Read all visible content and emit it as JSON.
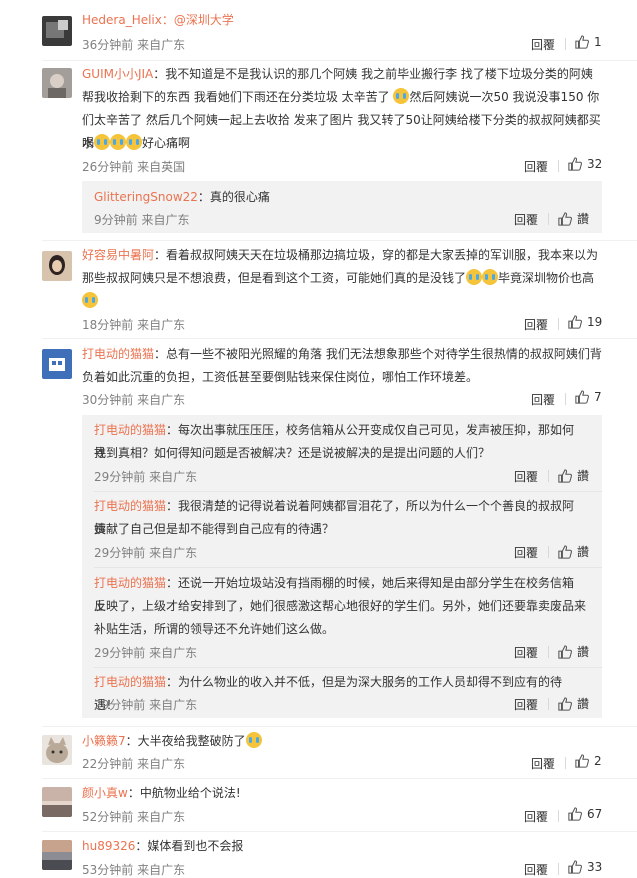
{
  "comments": [
    {
      "user": "Hedera_Helix",
      "text": "：@深圳大学",
      "time": "36分钟前 来自广东",
      "reply": "回覆",
      "likes": "1",
      "avatar": "dark"
    },
    {
      "user": "GUIM小小JIA",
      "lines": [
        "：我不知道是不是我认识的那几个阿姨 我之前毕业搬行李 找了楼下垃圾分类的阿姨",
        "帮我收拾剩下的东西 我看她们下雨还在分类垃圾 太辛苦了",
        "们太辛苦了 然后几个阿姨一起上去收拾 发来了图片 我又转了50让阿姨给楼下分类的叔叔阿姨都买水",
        "喝"
      ],
      "line2_suffix": "然后阿姨说一次50 我说没事150 你",
      "line4_suffix": "好心痛啊",
      "time": "26分钟前 来自英国",
      "reply": "回覆",
      "likes": "32",
      "avatar": "gray",
      "sub": [
        {
          "user": "GlitteringSnow22",
          "text": "：真的很心痛",
          "time": "9分钟前 来自广东",
          "reply": "回覆",
          "likes": "讚"
        }
      ]
    },
    {
      "user": "好容易中暑阿",
      "lines": [
        "：看着叔叔阿姨天天在垃圾桶那边搞垃圾，穿的都是大家丢掉的军训服，我本来以为",
        "那些叔叔阿姨只是不想浪费，但是看到这个工资，可能她们真的是没钱了"
      ],
      "line2_suffix": "毕竟深圳物价也高",
      "time": "18分钟前 来自广东",
      "reply": "回覆",
      "likes": "19",
      "avatar": "girl"
    },
    {
      "user": "打电动的猫猫",
      "lines": [
        "：总有一些不被阳光照耀的角落 我们无法想象那些个对待学生很热情的叔叔阿姨们背",
        "负着如此沉重的负担，工资低甚至要倒贴钱来保住岗位，哪怕工作环境差。"
      ],
      "time": "30分钟前 来自广东",
      "reply": "回覆",
      "likes": "7",
      "avatar": "blue",
      "sub": [
        {
          "user": "打电动的猫猫",
          "lines": [
            "：每次出事就压压压，校务信箱从公开变成仅自己可见，发声被压抑，那如何找",
            "寻到真相？如何得知问题是否被解决？还是说被解决的是提出问题的人们？"
          ],
          "time": "29分钟前 来自广东",
          "reply": "回覆",
          "likes": "讚"
        },
        {
          "user": "打电动的猫猫",
          "lines": [
            "：我很清楚的记得说着说着阿姨都冒泪花了，所以为什么一个个善良的叔叔阿姨",
            "贡献了自己但是却不能得到自己应有的待遇？"
          ],
          "time": "29分钟前 来自广东",
          "reply": "回覆",
          "likes": "讚"
        },
        {
          "user": "打电动的猫猫",
          "lines": [
            "：还说一开始垃圾站没有挡雨棚的时候，她后来得知是由部分学生在校务信箱上",
            "反映了，上级才给安排到了，她们很感激这帮心地很好的学生们。另外，她们还要靠卖废品来",
            "补贴生活，所谓的领导还不允许她们这么做。"
          ],
          "time": "29分钟前 来自广东",
          "reply": "回覆",
          "likes": "讚"
        },
        {
          "user": "打电动的猫猫",
          "text": "：为什么物业的收入并不低，但是为深大服务的工作人员却得不到应有的待遇！",
          "time": "29分钟前 来自广东",
          "reply": "回覆",
          "likes": "讚"
        }
      ]
    },
    {
      "user": "小籁籁7",
      "text": "：大半夜给我整破防了",
      "time": "22分钟前 来自广东",
      "reply": "回覆",
      "likes": "2",
      "avatar": "cat"
    },
    {
      "user": "颜小真w",
      "text": "：中航物业给个说法!",
      "time": "52分钟前 来自广东",
      "reply": "回覆",
      "likes": "67",
      "avatar": "sunset"
    },
    {
      "user": "hu89326",
      "text": "：媒体看到也不会报",
      "time": "53分钟前 来自广东",
      "reply": "回覆",
      "likes": "33",
      "avatar": "dusk"
    }
  ],
  "icons": {
    "like": "thumbs-up-icon",
    "emoji": "crying-face-icon"
  },
  "colors": {
    "username": "#eb7350",
    "meta": "#808080",
    "thread_bg": "#f2f2f2"
  }
}
